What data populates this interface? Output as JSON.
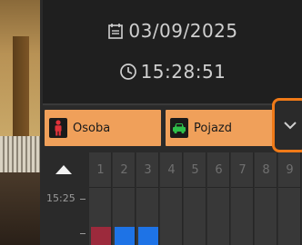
{
  "header": {
    "date": "03/09/2025",
    "time": "15:28:51"
  },
  "filters": {
    "person_label": "Osoba",
    "vehicle_label": "Pojazd"
  },
  "timeline": {
    "time_label": "15:25",
    "columns": [
      "1",
      "2",
      "3",
      "4",
      "5",
      "6",
      "7",
      "8",
      "9"
    ],
    "events": [
      {
        "column": "1",
        "color": "#9c2a3c"
      },
      {
        "column": "2",
        "color": "#1e73e6"
      },
      {
        "column": "3",
        "color": "#1e73e6"
      }
    ]
  },
  "colors": {
    "accent_orange": "#f07a18",
    "chip_bg": "#f0a05a",
    "person_icon": "#e0323a",
    "vehicle_icon": "#2fbf4a"
  }
}
